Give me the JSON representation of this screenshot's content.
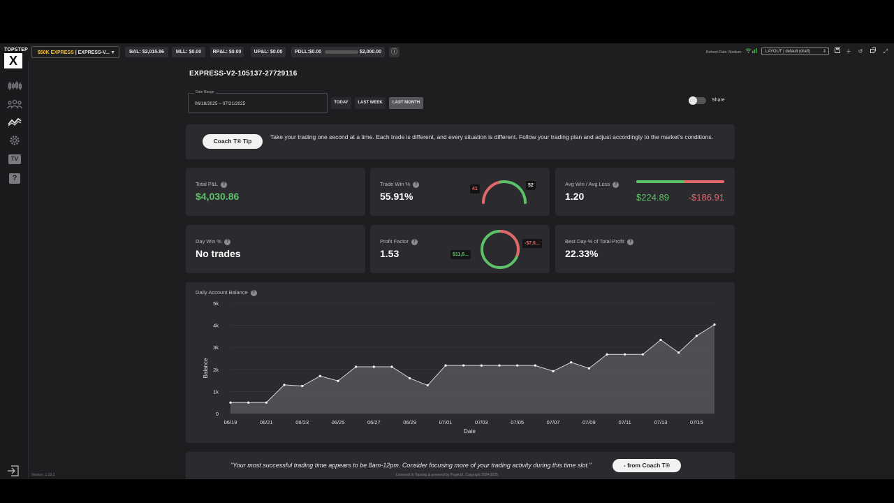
{
  "sidebar": {
    "brand": "TOPSTEP",
    "logo_letter": "X",
    "icons": [
      "candlestick-chart-icon",
      "users-icon",
      "analytics-icon",
      "settings-gear-icon",
      "tradingview-icon",
      "help-icon"
    ],
    "tv_label": "TV",
    "help_label": "?",
    "version": "Version: 1.19.3"
  },
  "topbar": {
    "account_prefix": "$50K EXPRESS",
    "account_sep": " | ",
    "account_name": "EXPRESS-V...",
    "bal": "BAL: $2,015.86",
    "mll": "MLL: $0.00",
    "rpl": "RP&L: $0.00",
    "upl": "UP&L: $0.00",
    "pdll": "PDLL:$0.00",
    "pdll_limit": "$2,000.00",
    "refresh_rate": "Refresh Rate: Medium",
    "layout": "LAYOUT | default (draft)"
  },
  "main": {
    "account_title": "EXPRESS-V2-105137-27729116",
    "date_range_label": "Date Range",
    "date_range_value": "06/18/2025 – 07/21/2025",
    "buttons": {
      "today": "TODAY",
      "last_week": "LAST WEEK",
      "last_month": "LAST MONTH"
    },
    "share": "Share",
    "coach_tip": {
      "button": "Coach T® Tip",
      "text": "Take your trading one second at a time. Each trade is different, and every situation is different. Follow your trading plan and adjust accordingly to the market's conditions."
    },
    "stats": {
      "total_pnl": {
        "label": "Total P&L",
        "value": "$4,030.86"
      },
      "trade_win": {
        "label": "Trade Win %",
        "value": "55.91%",
        "losses": "41",
        "wins": "52",
        "win_fraction": 0.5591
      },
      "avg_win_loss": {
        "label": "Avg Win / Avg Loss",
        "value": "1.20",
        "avg_win": "$224.89",
        "avg_loss": "-$186.91"
      },
      "day_win": {
        "label": "Day Win %",
        "value": "No trades"
      },
      "profit_factor": {
        "label": "Profit Factor",
        "value": "1.53",
        "gross_profit": "$11,6...",
        "gross_loss": "-$7,6..."
      },
      "best_day": {
        "label": "Best Day % of Total Profit",
        "value": "22.33%"
      }
    },
    "balance_chart_title": "Daily Account Balance",
    "coach_quote": "\"Your most successful trading time appears to be 8am-12pm. Consider focusing more of your trading activity during this time slot.\"",
    "coach_from": "- from Coach T®"
  },
  "chart_data": {
    "type": "area",
    "title": "Daily Account Balance",
    "xlabel": "Date",
    "ylabel": "Balance",
    "ylim": [
      0,
      5000
    ],
    "yticks": [
      "0",
      "1k",
      "2k",
      "3k",
      "4k",
      "5k"
    ],
    "xtick_labels": [
      "06/19",
      "06/21",
      "06/23",
      "06/25",
      "06/27",
      "06/29",
      "07/01",
      "07/03",
      "07/05",
      "07/07",
      "07/09",
      "07/11",
      "07/13",
      "07/15"
    ],
    "x": [
      "06/19",
      "06/20",
      "06/21",
      "06/22",
      "06/23",
      "06/24",
      "06/25",
      "06/26",
      "06/27",
      "06/28",
      "06/29",
      "06/30",
      "07/01",
      "07/02",
      "07/03",
      "07/04",
      "07/05",
      "07/06",
      "07/07",
      "07/08",
      "07/09",
      "07/10",
      "07/11",
      "07/12",
      "07/13",
      "07/14",
      "07/15",
      "07/16"
    ],
    "values": [
      500,
      500,
      500,
      1300,
      1250,
      1700,
      1480,
      2120,
      2120,
      2120,
      1600,
      1280,
      2180,
      2180,
      2180,
      2180,
      2180,
      2180,
      1920,
      2320,
      2050,
      2680,
      2680,
      2680,
      3340,
      2760,
      3520,
      4030
    ],
    "grid": true,
    "colors": {
      "line": "#d8d8d8",
      "fill": "#55555a",
      "point": "#ffffff"
    }
  },
  "colors": {
    "accent_gold": "#f5c542",
    "positive": "#5cc268",
    "negative": "#e0686b",
    "background": "#1e1e21",
    "card": "#2a2a2f"
  }
}
